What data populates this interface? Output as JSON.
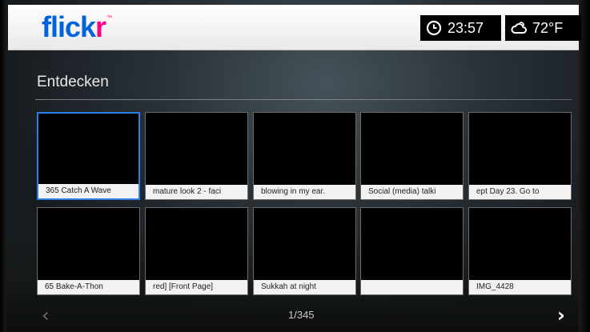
{
  "header": {
    "logo_flick": "flick",
    "logo_r": "r",
    "logo_tm": "™",
    "time": "23:57",
    "temperature": "72°F",
    "icons": [
      "clock-icon",
      "weather-cloud-icon"
    ]
  },
  "section": {
    "title": "Entdecken"
  },
  "photos": [
    {
      "caption": "365 Catch A Wave",
      "selected": true
    },
    {
      "caption": "mature look 2 - faci"
    },
    {
      "caption": "blowing in my ear."
    },
    {
      "caption": "Social (media) talki"
    },
    {
      "caption": "ept Day 23. Go to"
    },
    {
      "caption": "65 Bake-A-Thon"
    },
    {
      "caption": "red] [Front Page]"
    },
    {
      "caption": "Sukkah at night"
    },
    {
      "caption": ""
    },
    {
      "caption": "IMG_4428"
    }
  ],
  "pager": {
    "current": "1",
    "total": "/345",
    "prev_icon": "chevron-left-icon",
    "next_icon": "chevron-right-icon"
  },
  "colors": {
    "flickr_blue": "#0063dc",
    "flickr_pink": "#ff0084",
    "selection": "#2f7fe6"
  }
}
